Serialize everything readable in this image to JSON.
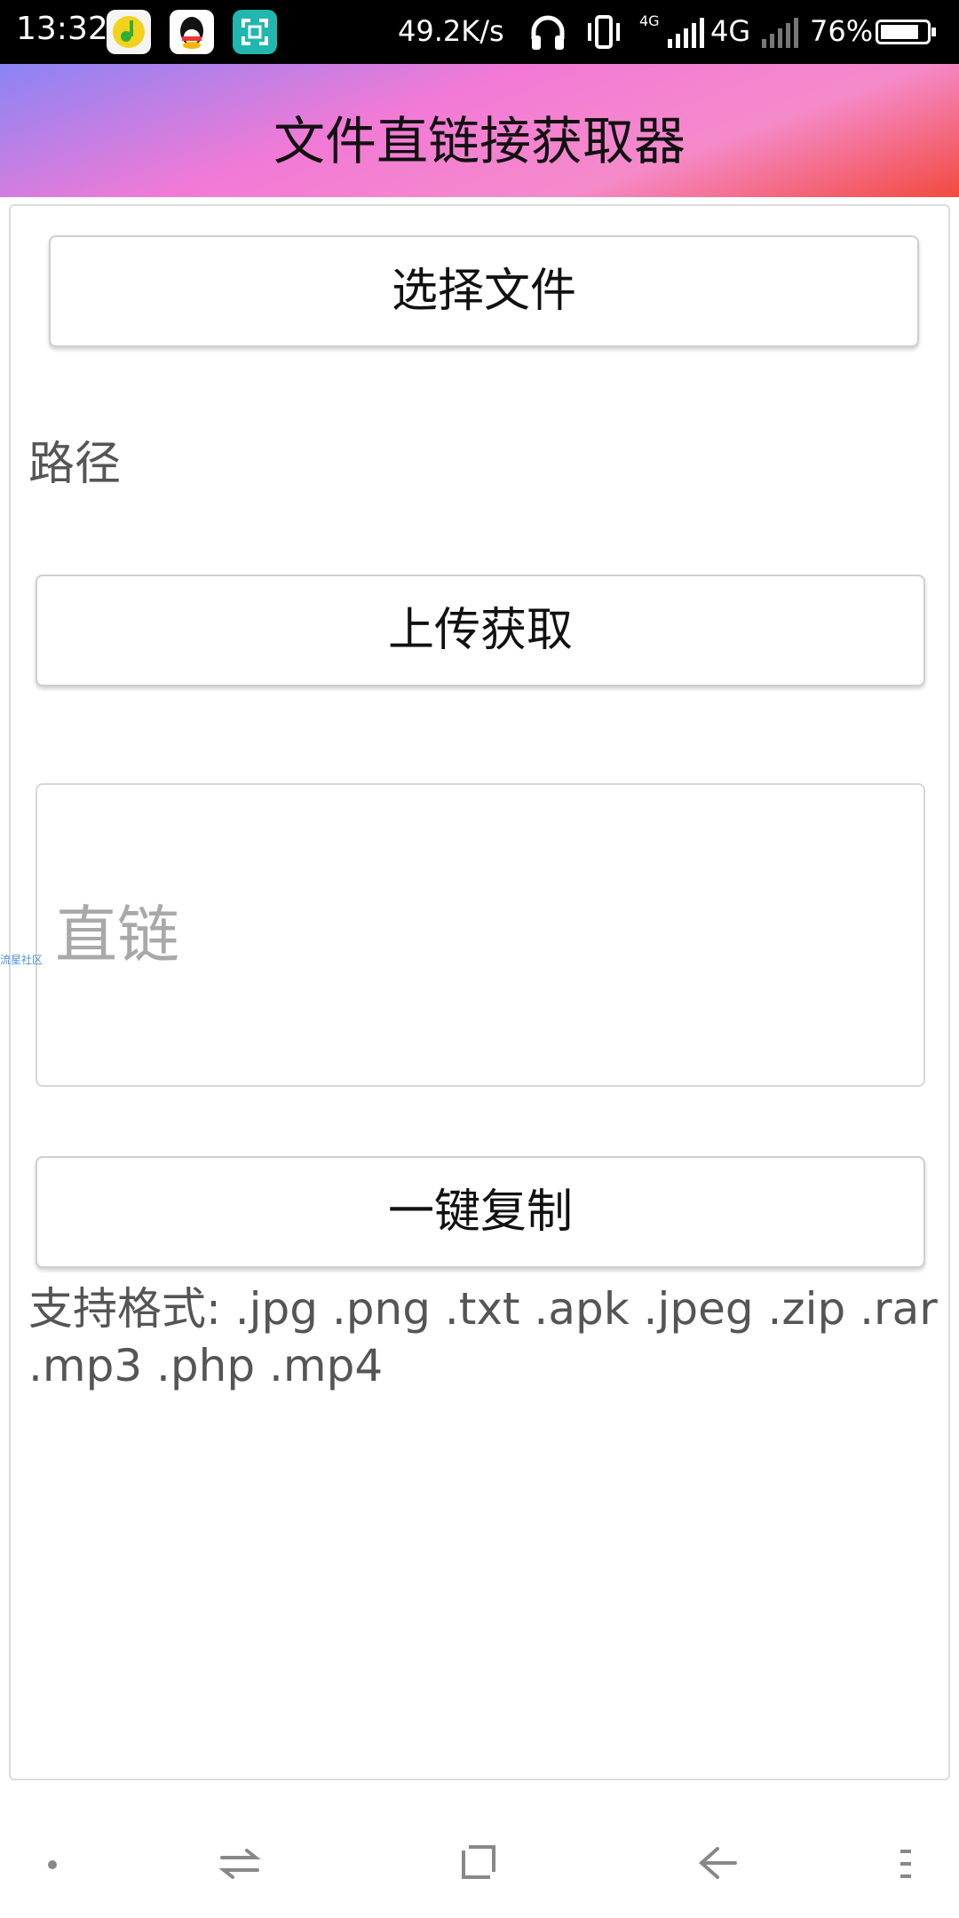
{
  "status_bar": {
    "time": "13:32",
    "speed": "49.2K/s",
    "network": "4G",
    "network_small": "4G",
    "battery": "76%",
    "battery_level": 0.76
  },
  "header": {
    "title": "文件直链接获取器"
  },
  "main": {
    "choose_label": "选择文件",
    "path_label": "路径",
    "upload_label": "上传获取",
    "link_placeholder": "直链",
    "copy_label": "一键复制",
    "formats_text": "支持格式: .jpg .png .txt .apk .jpeg .zip .rar .mp3 .php .mp4",
    "watermark": "流星社区"
  },
  "colors": {
    "header_gradient": [
      "#8a84f5",
      "#f27ad6",
      "#f24a3e"
    ],
    "teal_icon": "#22b6b0"
  },
  "icons": [
    "music-app-icon",
    "qq-app-icon",
    "scan-app-icon",
    "headphones-icon",
    "vibrate-icon",
    "signal-icon",
    "battery-icon",
    "dot-icon",
    "switch-icon",
    "home-square-icon",
    "back-icon",
    "menu-icon"
  ]
}
